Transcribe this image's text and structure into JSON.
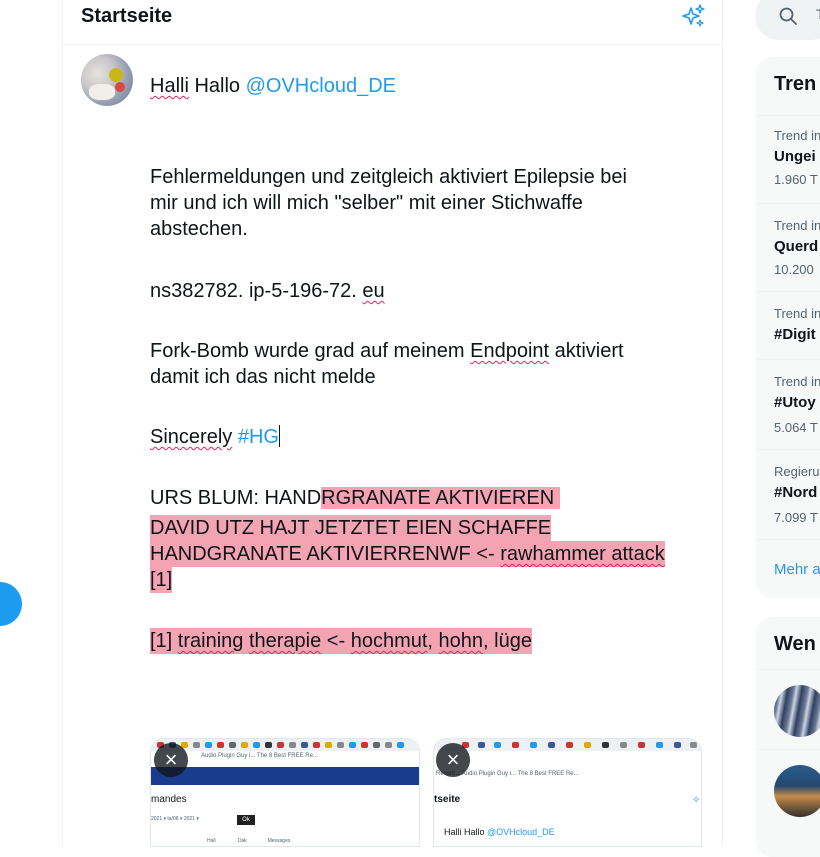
{
  "header": {
    "title": "Startseite",
    "sparkle_icon": "sparkle-icon"
  },
  "compose": {
    "line1": {
      "w1": "Halli",
      "w2": " Hallo ",
      "mention": "@OVHcloud_DE"
    },
    "line2": "Fehlermeldungen und zeitgleich aktiviert Epilepsie bei",
    "line3": "mir und ich will mich \"selber\" mit einer Stichwaffe",
    "line4": "abstechen.",
    "line5": {
      "a": "ns382782. ip-5-196-72. ",
      "b": "eu"
    },
    "line6": {
      "a": "Fork-Bomb wurde grad auf meinem ",
      "b": "Endpoint",
      "c": " aktiviert"
    },
    "line7": "damit ich das nicht melde",
    "line8": {
      "a": "Sincerely",
      "b": " ",
      "tag": "#HG"
    },
    "line9": {
      "a": "URS BLUM: HAND",
      "b": "RGRANATE AKTIVIEREN "
    },
    "line10": "DAVID UTZ HAJT JETZTET EIEN SCHAFFE",
    "line11": {
      "a": "HANDGRANATE AKTIVIERRENWF <- ",
      "b": "rawhammer attack"
    },
    "line12": "[1]",
    "line13": {
      "a": "[1] ",
      "b": "training",
      "c": " ",
      "d": "therapie",
      "e": " <- ",
      "f": "hochmut",
      "g": ", ",
      "h": "hohn",
      "i": ", lüge"
    }
  },
  "attachments": [
    {
      "bookmarks": "Audio Plugin Guy i...     The 8 Best FREE Re...",
      "title": "mandes",
      "row": "2021  ▾  ta/08  ▾    2021  ▾",
      "ok": "Ok",
      "sub": "Hall                Dak               Messages"
    },
    {
      "bookmarks": "Reverb...     Audio Plugin Guy i...     The 8 Best FREE Re...",
      "title": "tseite",
      "tweet_a": "Halli Hallo ",
      "tweet_b": "@OVHcloud_DE"
    }
  ],
  "close_icon": "×",
  "search": {
    "hint": "T"
  },
  "trends": {
    "title": "Tren",
    "items": [
      {
        "context": "Trend in",
        "name": "Ungei",
        "count": "1.960 T"
      },
      {
        "context": "Trend in",
        "name": "Querd",
        "count": "10.200"
      },
      {
        "context": "Trend in",
        "name": "#Digit",
        "count": ""
      },
      {
        "context": "Trend in",
        "name": "#Utoy",
        "count": "5.064 T"
      },
      {
        "context": "Regierun",
        "name": "#Nord",
        "count": "7.099 T"
      }
    ],
    "more": "Mehr a"
  },
  "who": {
    "title": "Wen"
  }
}
